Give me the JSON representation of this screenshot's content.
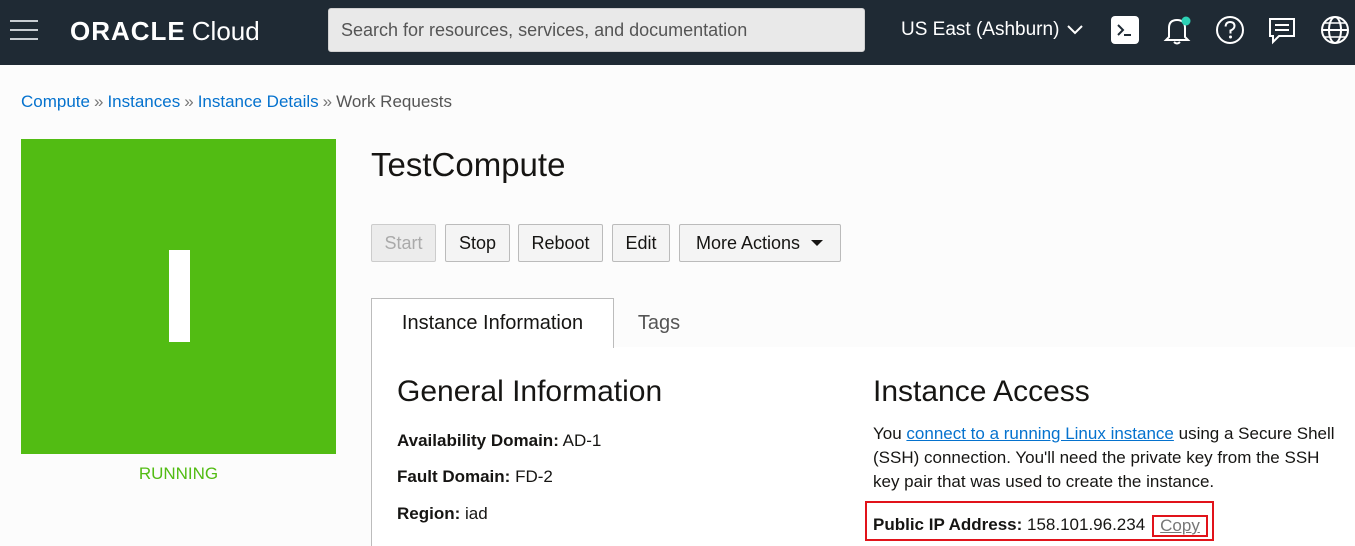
{
  "header": {
    "logo_brand": "ORACLE",
    "logo_product": "Cloud",
    "search_placeholder": "Search for resources, services, and documentation",
    "region": "US East (Ashburn)",
    "icons": [
      "hamburger-menu-icon",
      "cloud-shell-icon",
      "bell-icon",
      "help-icon",
      "chat-icon",
      "globe-icon"
    ],
    "colors": {
      "bar": "#1f2a34",
      "notification_dot": "#2dd1b5"
    }
  },
  "breadcrumb": {
    "items": [
      "Compute",
      "Instances",
      "Instance Details",
      "Work Requests"
    ],
    "separator": "»"
  },
  "instance": {
    "tile_letter": "I",
    "status": "RUNNING",
    "status_color": "#52bc13",
    "name": "TestCompute"
  },
  "actions": {
    "start": "Start",
    "stop": "Stop",
    "reboot": "Reboot",
    "edit": "Edit",
    "more": "More Actions"
  },
  "tabs": {
    "active": "Instance Information",
    "other": "Tags"
  },
  "general": {
    "title": "General Information",
    "availability_domain_label": "Availability Domain:",
    "availability_domain_value": "AD-1",
    "fault_domain_label": "Fault Domain:",
    "fault_domain_value": "FD-2",
    "region_label": "Region:",
    "region_value": "iad"
  },
  "access": {
    "title": "Instance Access",
    "text_before": "You ",
    "link": "connect to a running Linux instance",
    "text_after": " using a Secure Shell (SSH) connection. You'll need the private key from the SSH key pair that was used to create the instance.",
    "public_ip_label": "Public IP Address:",
    "public_ip_value": "158.101.96.234",
    "copy_label": "Copy",
    "highlight_color": "#e1131a"
  }
}
